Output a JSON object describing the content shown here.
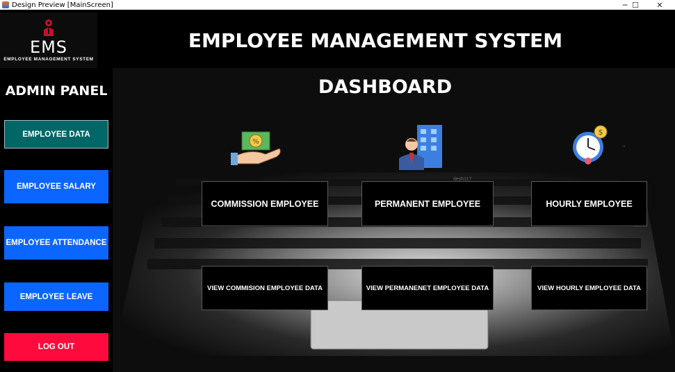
{
  "window": {
    "title": "Design Preview [MainScreen]",
    "controls": {
      "minimize": "─",
      "maximize": "☐",
      "close": "✕"
    }
  },
  "header": {
    "logo_text": "EMS",
    "logo_subtext": "EMPLOYEE MANAGEMENT SYSTEM",
    "title": "EMPLOYEE MANAGEMENT SYSTEM"
  },
  "sidebar": {
    "title": "ADMIN PANEL",
    "items": [
      {
        "label": "EMPLOYEE DATA",
        "color": "#006666"
      },
      {
        "label": "EMPLOYEE SALARY",
        "color": "#0a66ff"
      },
      {
        "label": "EMPLOYEE ATTENDANCE",
        "color": "#0a66ff"
      },
      {
        "label": "EMPLOYEE LEAVE",
        "color": "#0a66ff"
      },
      {
        "label": "LOG OUT",
        "color": "#ff0a3c"
      }
    ]
  },
  "dashboard": {
    "title": "DASHBOARD",
    "icons": [
      "commission-hand-money-icon",
      "businessman-building-icon",
      "hourly-clock-icon"
    ],
    "tiles": [
      {
        "label": "COMMISSION EMPLOYEE"
      },
      {
        "label": "PERMANENT EMPLOYEE"
      },
      {
        "label": "HOURLY EMPLOYEE"
      },
      {
        "label": "VIEW COMMISION EMPLOYEE DATA"
      },
      {
        "label": "VIEW PERMANENET EMPLOYEE DATA"
      },
      {
        "label": "VIEW HOURLY EMPLOYEE DATA"
      }
    ],
    "dots": "..",
    "faint_label": "desh117"
  }
}
